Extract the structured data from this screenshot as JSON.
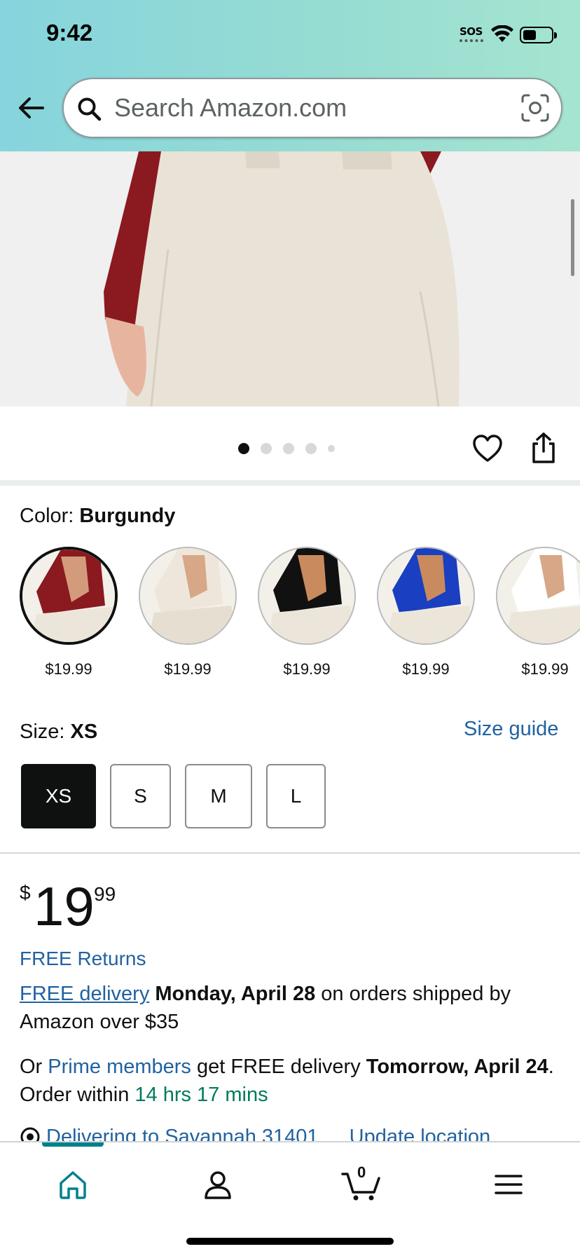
{
  "status_bar": {
    "time": "9:42",
    "sos": "SOS"
  },
  "search": {
    "placeholder": "Search Amazon.com"
  },
  "icons": {
    "back": "arrow-left-icon",
    "search": "search-icon",
    "camera": "camera-scan-icon",
    "heart": "heart-icon",
    "share": "share-icon",
    "home": "home-icon",
    "account": "person-icon",
    "cart": "cart-icon",
    "menu": "menu-icon",
    "location": "location-pin-icon"
  },
  "gallery": {
    "total_images": 5,
    "active_index": 0
  },
  "color": {
    "label": "Color:",
    "selected": "Burgundy",
    "swatches": [
      {
        "name": "Burgundy",
        "price": "$19.99",
        "color": "#8a1a1f",
        "selected": true
      },
      {
        "name": "Beige",
        "price": "$19.99",
        "color": "#eee6db",
        "selected": false
      },
      {
        "name": "Black",
        "price": "$19.99",
        "color": "#111111",
        "selected": false
      },
      {
        "name": "Royal Blue",
        "price": "$19.99",
        "color": "#1a3fc0",
        "selected": false
      },
      {
        "name": "White",
        "price": "$19.99",
        "color": "#ffffff",
        "selected": false
      }
    ]
  },
  "size": {
    "label": "Size:",
    "selected": "XS",
    "guide": "Size guide",
    "options": [
      "XS",
      "S",
      "M",
      "L"
    ]
  },
  "price": {
    "symbol": "$",
    "whole": "19",
    "fraction": "99"
  },
  "shipping": {
    "free_returns": "FREE Returns",
    "delivery_link": "FREE delivery",
    "delivery_date": "Monday, April 28",
    "delivery_rest": "on orders shipped by Amazon over $35",
    "prime_prefix": "Or",
    "prime_link": "Prime members",
    "prime_mid": "get FREE delivery",
    "prime_date": "Tomorrow, April 24",
    "prime_order": ". Order within",
    "prime_countdown": "14 hrs 17 mins",
    "deliver_to": "Delivering to Savannah 31401",
    "update_location": "Update location"
  },
  "bottom_nav": {
    "cart_count": "0"
  },
  "colors": {
    "link": "#2162a1",
    "accent": "#00818a",
    "green": "#007a5e"
  }
}
